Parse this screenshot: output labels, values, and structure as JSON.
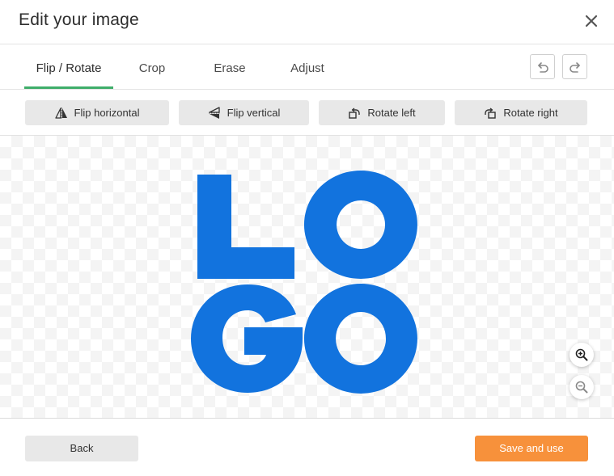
{
  "dialog": {
    "title": "Edit your image"
  },
  "tabs": [
    {
      "label": "Flip / Rotate",
      "active": true
    },
    {
      "label": "Crop",
      "active": false
    },
    {
      "label": "Erase",
      "active": false
    },
    {
      "label": "Adjust",
      "active": false
    }
  ],
  "history": {
    "undo_icon": "undo-icon",
    "redo_icon": "redo-icon"
  },
  "toolbar": {
    "flip_horizontal": "Flip horizontal",
    "flip_vertical": "Flip vertical",
    "rotate_left": "Rotate left",
    "rotate_right": "Rotate right"
  },
  "canvas": {
    "image_text": "LOGO",
    "logo_color": "#1273de",
    "zoom_in_icon": "zoom-in-icon",
    "zoom_out_icon": "zoom-out-icon"
  },
  "footer": {
    "back_label": "Back",
    "save_label": "Save and use"
  },
  "colors": {
    "active_tab_underline": "#3fae6a",
    "primary_button": "#f7913b",
    "secondary_button": "#e8e8e8"
  }
}
